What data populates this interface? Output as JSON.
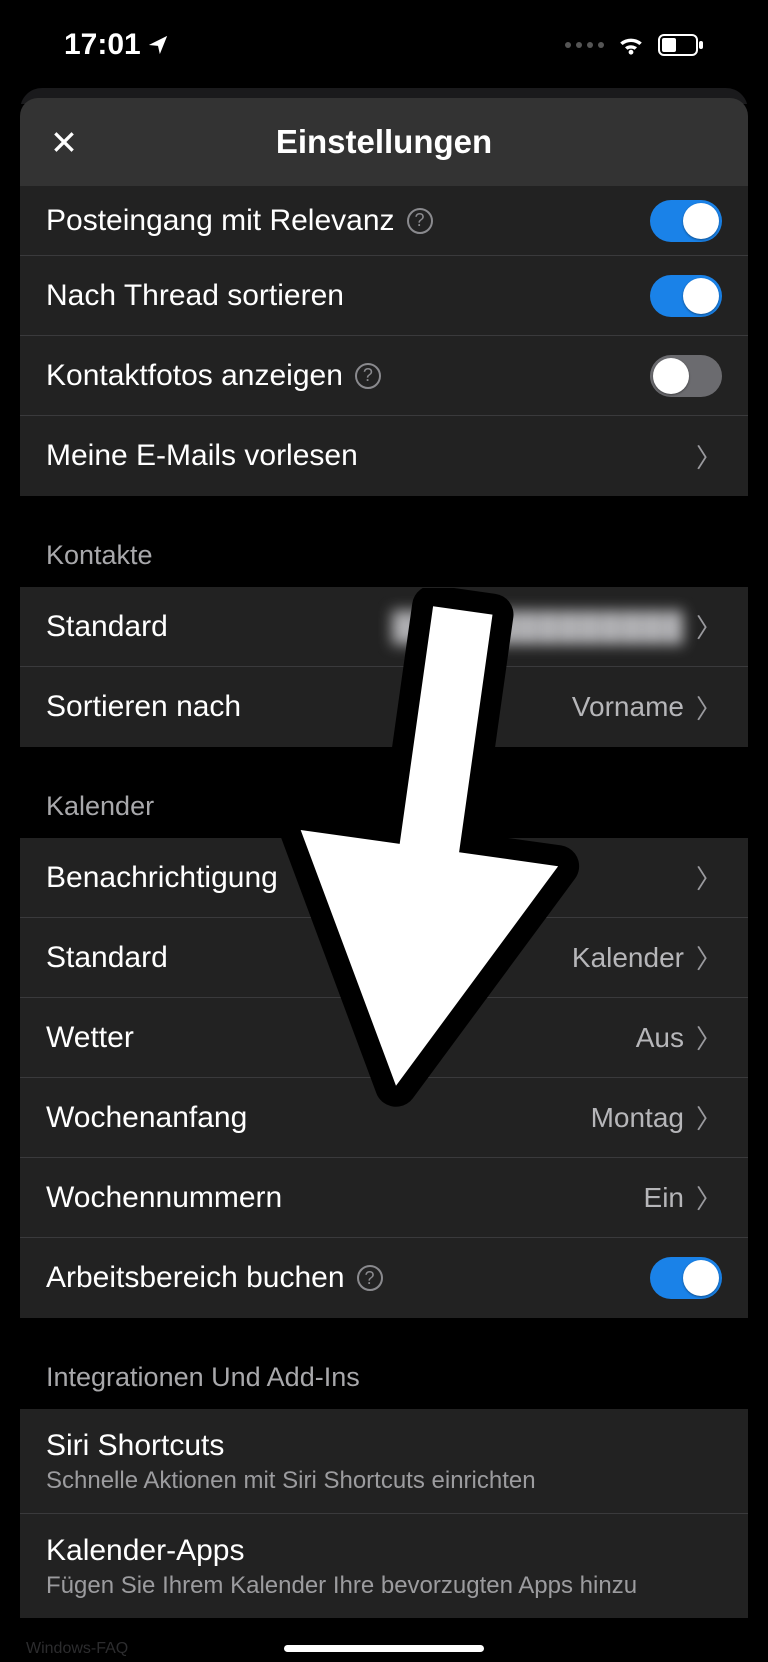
{
  "status": {
    "time": "17:01"
  },
  "header": {
    "title": "Einstellungen"
  },
  "mail": {
    "focused_inbox": "Posteingang mit Relevanz",
    "sort_by_thread": "Nach Thread sortieren",
    "show_contact_photos": "Kontaktfotos anzeigen",
    "read_my_emails": "Meine E-Mails vorlesen",
    "focused_on": true,
    "thread_on": true,
    "photos_on": false
  },
  "contacts": {
    "header": "Kontakte",
    "default_label": "Standard",
    "default_value": "██████████████",
    "sort_label": "Sortieren nach",
    "sort_value": "Vorname"
  },
  "calendar": {
    "header": "Kalender",
    "notifications": "Benachrichtigung",
    "default_label": "Standard",
    "default_value": "Kalender",
    "weather_label": "Wetter",
    "weather_value": "Aus",
    "week_start_label": "Wochenanfang",
    "week_start_value": "Montag",
    "week_numbers_label": "Wochennummern",
    "week_numbers_value": "Ein",
    "book_workspace_label": "Arbeitsbereich buchen",
    "book_workspace_on": true
  },
  "integrations": {
    "header": "Integrationen Und Add-Ins",
    "siri_title": "Siri Shortcuts",
    "siri_sub": "Schnelle Aktionen mit Siri Shortcuts einrichten",
    "cal_apps_title": "Kalender-Apps",
    "cal_apps_sub": "Fügen Sie Ihrem Kalender Ihre bevorzugten Apps hinzu"
  },
  "watermark": "Windows-FAQ"
}
